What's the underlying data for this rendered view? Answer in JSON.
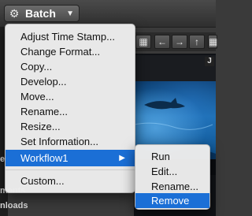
{
  "toolbar": {
    "batch_label": "Batch"
  },
  "content": {
    "label_tag": "J"
  },
  "sidebar_fragments": [
    "e",
    "ments",
    "nloads"
  ],
  "menu": {
    "items": [
      {
        "label": "Adjust Time Stamp..."
      },
      {
        "label": "Change Format..."
      },
      {
        "label": "Copy..."
      },
      {
        "label": "Develop..."
      },
      {
        "label": "Move..."
      },
      {
        "label": "Rename..."
      },
      {
        "label": "Resize..."
      },
      {
        "label": "Set Information..."
      },
      {
        "label": "Workflow1"
      },
      {
        "label": "Custom..."
      }
    ],
    "selected": "Workflow1"
  },
  "submenu": {
    "items": [
      {
        "label": "Run"
      },
      {
        "label": "Edit..."
      },
      {
        "label": "Rename..."
      },
      {
        "label": "Remove"
      }
    ],
    "selected": "Remove"
  },
  "colors": {
    "highlight": "#1b6fd6"
  }
}
